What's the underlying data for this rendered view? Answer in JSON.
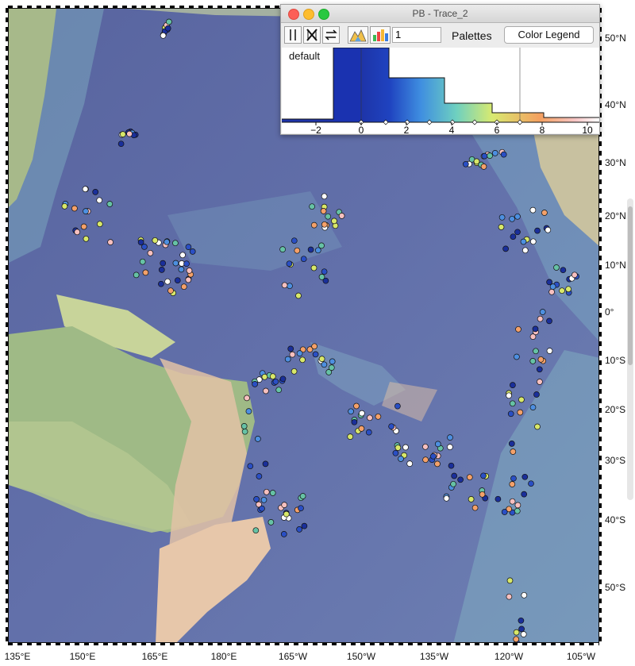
{
  "map": {
    "lon_labels": [
      "135°E",
      "150°E",
      "165°E",
      "180°E",
      "165°W",
      "150°W",
      "135°W",
      "120°W",
      "105°W"
    ],
    "lat_labels": [
      "50°N",
      "40°N",
      "30°N",
      "20°N",
      "10°N",
      "0°",
      "10°S",
      "20°S",
      "30°S",
      "40°S",
      "50°S"
    ],
    "colors": {
      "ocean": "#5d6aa6",
      "ridge": "#8fb7c9",
      "land_green": "#8bb08a",
      "land_tan": "#e0c0a0"
    },
    "points_note_colors": [
      "#2a4fc4",
      "#1a2f9a",
      "#4d8fe0",
      "#66c2a5",
      "#d8e86a",
      "#f4a16a",
      "#f7c0c0",
      "#ffffff"
    ]
  },
  "window": {
    "title": "PB - Trace_2",
    "zoom_value": "1",
    "palettes_label": "Palettes",
    "color_legend_button": "Color Legend",
    "palette_name": "default",
    "axis_ticks": [
      "−2",
      "0",
      "2",
      "4",
      "6",
      "8",
      "10"
    ]
  }
}
